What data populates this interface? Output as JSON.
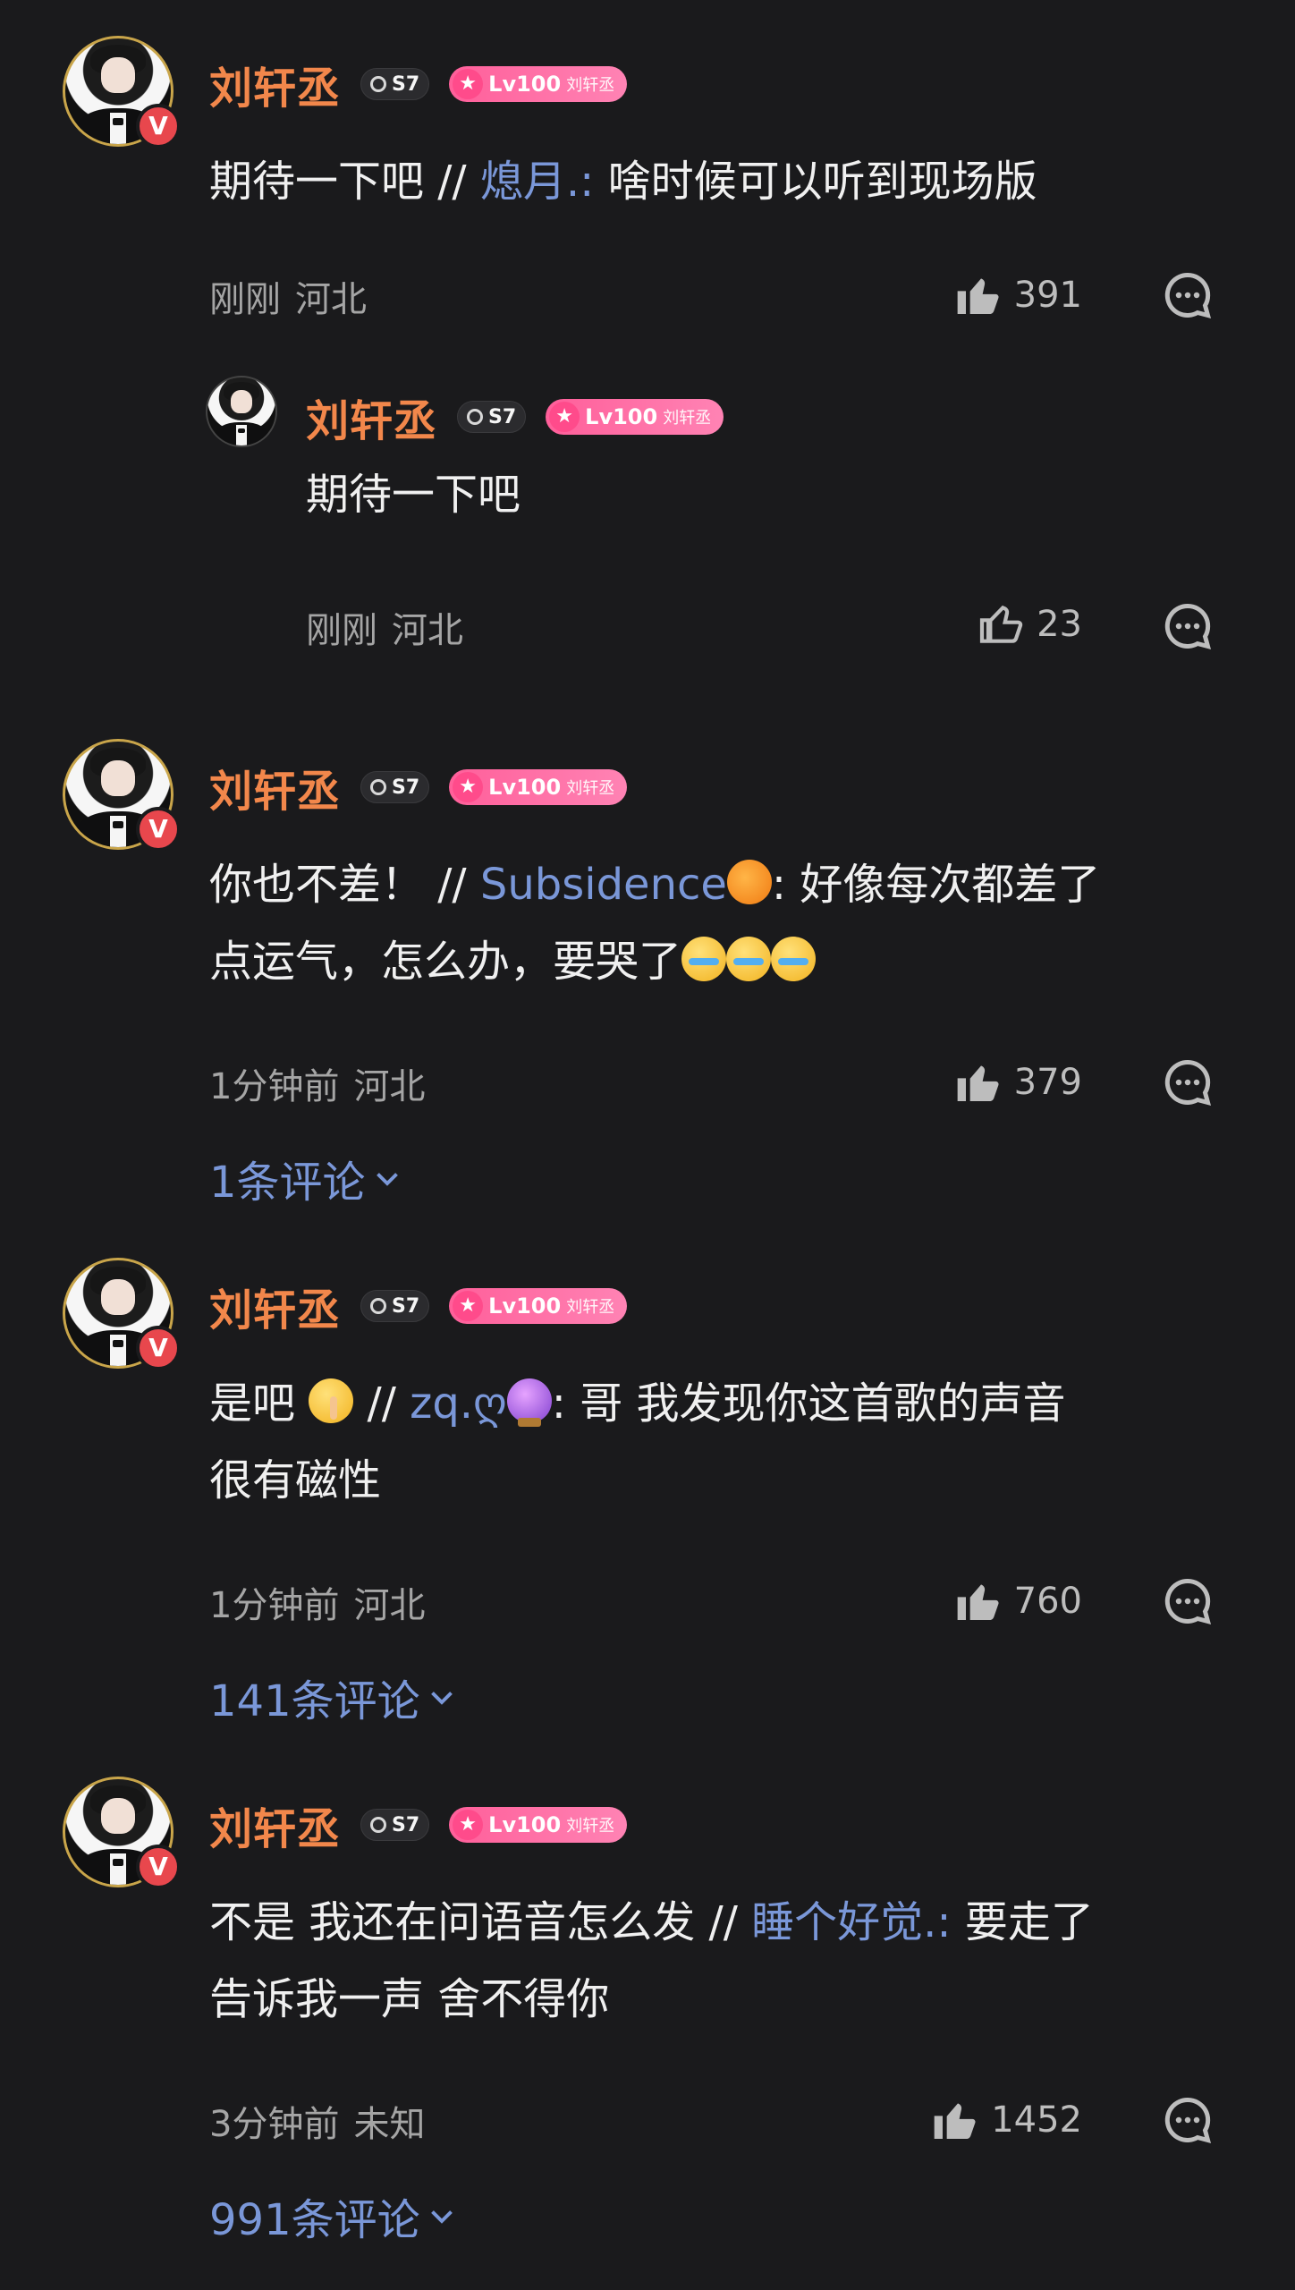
{
  "comments": [
    {
      "user": {
        "name": "刘轩丞",
        "rank": "S7",
        "level": "Lv100",
        "level_name": "刘轩丞"
      },
      "text_prefix": "期待一下吧 // ",
      "quote_user": "熄月.:",
      "quote_text": " 啥时候可以听到现场版",
      "time": "刚刚",
      "location": "河北",
      "likes": "391",
      "reply": {
        "user": {
          "name": "刘轩丞",
          "rank": "S7",
          "level": "Lv100",
          "level_name": "刘轩丞"
        },
        "text": "期待一下吧",
        "time": "刚刚",
        "location": "河北",
        "likes": "23"
      }
    },
    {
      "user": {
        "name": "刘轩丞",
        "rank": "S7",
        "level": "Lv100",
        "level_name": "刘轩丞"
      },
      "text_prefix": "你也不差！ // ",
      "quote_user": "Subsidence",
      "quote_text_1": ": 好像每次都差了",
      "quote_text_2": "点运气，怎么办，要哭了",
      "time": "1分钟前",
      "location": "河北",
      "likes": "379",
      "replies_label": "1条评论"
    },
    {
      "user": {
        "name": "刘轩丞",
        "rank": "S7",
        "level": "Lv100",
        "level_name": "刘轩丞"
      },
      "text_prefix": "是吧 ",
      "text_mid": " // ",
      "quote_user": "zq.ღ",
      "quote_text_1": ": 哥 我发现你这首歌的声音",
      "quote_text_2": "很有磁性",
      "time": "1分钟前",
      "location": "河北",
      "likes": "760",
      "replies_label": "141条评论"
    },
    {
      "user": {
        "name": "刘轩丞",
        "rank": "S7",
        "level": "Lv100",
        "level_name": "刘轩丞"
      },
      "text_prefix": "不是 我还在问语音怎么发 // ",
      "quote_user": "睡个好觉.:",
      "quote_text_1": " 要走了",
      "quote_text_2": "告诉我一声 舍不得你",
      "time": "3分钟前",
      "location": "未知",
      "likes": "1452",
      "replies_label": "991条评论"
    }
  ],
  "icons": {
    "like": "thumbs-up-icon",
    "comment": "comment-bubble-icon",
    "expand": "chevron-down-icon",
    "verified": "verified-v-badge"
  },
  "colors": {
    "background": "#1a1a1c",
    "username": "#f2874b",
    "link": "#7a97d8",
    "meta": "#a5a5a5",
    "level_pill": "#ff5f9a",
    "verified_badge": "#e8474d"
  }
}
